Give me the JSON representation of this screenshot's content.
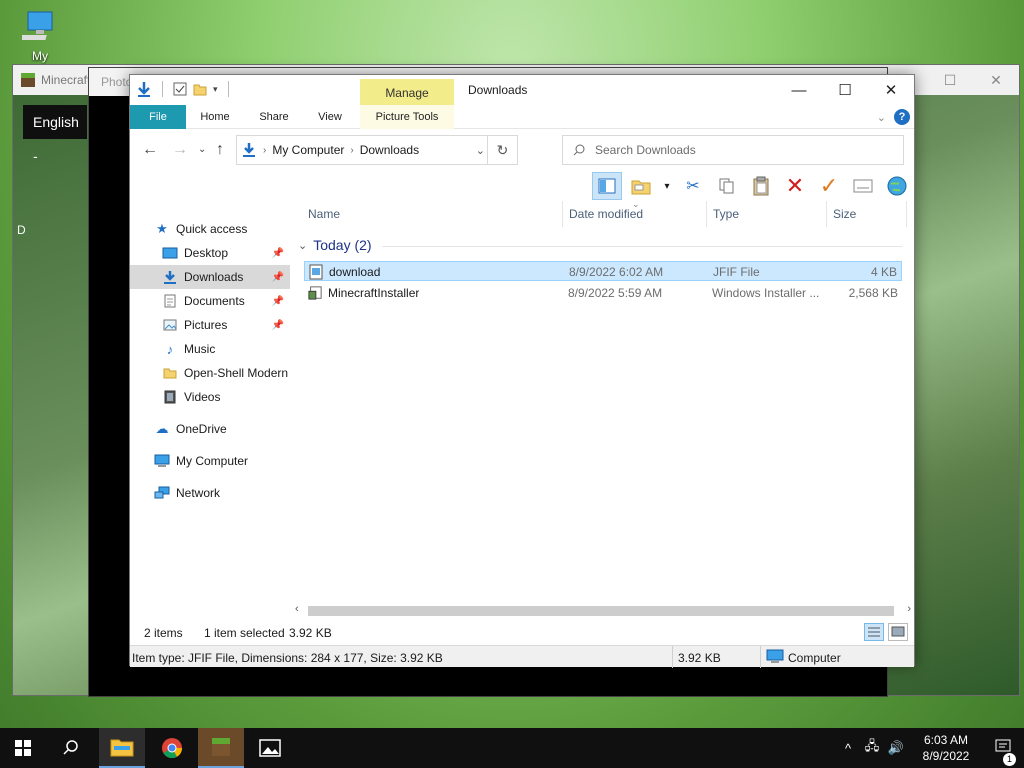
{
  "desktop": {
    "icon_label": "My Computer"
  },
  "minecraft": {
    "title": "Minecraft",
    "language": "English -",
    "side_letter": "D"
  },
  "photos": {
    "title": "Photo"
  },
  "explorer": {
    "title": "Downloads",
    "manage_label": "Manage",
    "tabs": {
      "file": "File",
      "home": "Home",
      "share": "Share",
      "view": "View",
      "picture_tools": "Picture Tools"
    },
    "address": {
      "root": "My Computer",
      "current": "Downloads"
    },
    "search_placeholder": "Search Downloads",
    "nav": {
      "quick_access": "Quick access",
      "desktop": "Desktop",
      "downloads": "Downloads",
      "documents": "Documents",
      "pictures": "Pictures",
      "music": "Music",
      "open_shell": "Open-Shell Modern",
      "videos": "Videos",
      "onedrive": "OneDrive",
      "my_computer": "My Computer",
      "network": "Network"
    },
    "columns": {
      "name": "Name",
      "date": "Date modified",
      "type": "Type",
      "size": "Size"
    },
    "group_label": "Today (2)",
    "files": [
      {
        "name": "download",
        "date": "8/9/2022 6:02 AM",
        "type": "JFIF File",
        "size": "4 KB"
      },
      {
        "name": "MinecraftInstaller",
        "date": "8/9/2022 5:59 AM",
        "type": "Windows Installer ...",
        "size": "2,568 KB"
      }
    ],
    "status": {
      "items": "2 items",
      "selected": "1 item selected",
      "selected_size": "3.92 KB"
    },
    "details": {
      "info": "Item type: JFIF File, Dimensions: 284 x 177, Size: 3.92 KB",
      "size": "3.92 KB",
      "location": "Computer"
    }
  },
  "taskbar": {
    "time": "6:03 AM",
    "date": "8/9/2022",
    "notification_count": "1"
  }
}
